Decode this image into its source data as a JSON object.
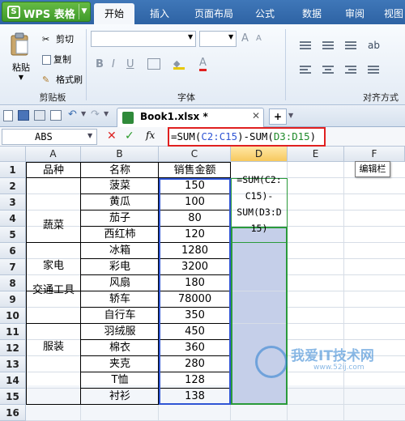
{
  "app": {
    "name": "WPS 表格",
    "logo_letter": "S"
  },
  "ribbon_tabs": [
    "开始",
    "插入",
    "页面布局",
    "公式",
    "数据",
    "审阅",
    "视图"
  ],
  "clipboard": {
    "paste_label": "粘贴",
    "cut_label": "剪切",
    "copy_label": "复制",
    "format_painter_label": "格式刷",
    "group_label": "剪贴板"
  },
  "font_group": {
    "label": "字体"
  },
  "align_group": {
    "label": "对齐方式"
  },
  "document": {
    "tab_title": "Book1.xlsx *",
    "add_tab": "+"
  },
  "formula_bar": {
    "name_box": "ABS",
    "fx_label": "fx",
    "formula_parts": [
      "=SUM(",
      "C2:C15",
      ")-SUM(",
      "D3:D15",
      ")"
    ],
    "tooltip": "编辑栏"
  },
  "columns": [
    "A",
    "B",
    "C",
    "D",
    "E",
    "F"
  ],
  "rows": [
    "1",
    "2",
    "3",
    "4",
    "5",
    "6",
    "7",
    "8",
    "9",
    "10",
    "11",
    "12",
    "13",
    "14",
    "15",
    "16"
  ],
  "headers": {
    "a": "品种",
    "b": "名称",
    "c": "销售金额"
  },
  "categories": [
    "蔬菜",
    "家电",
    "交通工具",
    "服装"
  ],
  "items": [
    {
      "name": "菠菜",
      "amount": "150"
    },
    {
      "name": "黄瓜",
      "amount": "100"
    },
    {
      "name": "茄子",
      "amount": "80"
    },
    {
      "name": "西红柿",
      "amount": "120"
    },
    {
      "name": "冰箱",
      "amount": "1280"
    },
    {
      "name": "彩电",
      "amount": "3200"
    },
    {
      "name": "风扇",
      "amount": "180"
    },
    {
      "name": "轿车",
      "amount": "78000"
    },
    {
      "name": "自行车",
      "amount": "350"
    },
    {
      "name": "羽绒服",
      "amount": "450"
    },
    {
      "name": "棉衣",
      "amount": "360"
    },
    {
      "name": "夹克",
      "amount": "280"
    },
    {
      "name": "T恤",
      "amount": "128"
    },
    {
      "name": "衬衫",
      "amount": "138"
    }
  ],
  "d2_formula_lines": [
    "=SUM(C2:",
    "C15)-",
    "SUM(D3:D",
    "15)"
  ],
  "watermark": {
    "main": "我爱IT技术网",
    "sub": "www.52ij.com"
  }
}
